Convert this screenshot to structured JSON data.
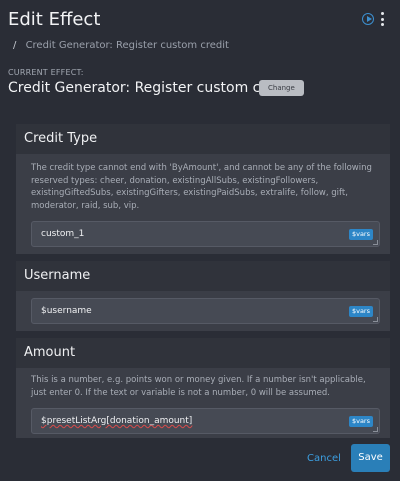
{
  "header": {
    "title": "Edit Effect",
    "play_icon": "play-circle-icon",
    "menu_icon": "kebab-menu-icon"
  },
  "breadcrumb": {
    "separator": "/",
    "current": "Credit Generator: Register custom credit"
  },
  "current_effect": {
    "label": "CURRENT EFFECT:",
    "name": "Credit Generator: Register custom credit",
    "change_label": "Change"
  },
  "credit_type": {
    "heading": "Credit Type",
    "description": "The credit type cannot end with 'ByAmount', and cannot be any of the following reserved types: cheer, donation, existingAllSubs, existingFollowers, existingGiftedSubs, existingGifters, existingPaidSubs, extralife, follow, gift, moderator, raid, sub, vip.",
    "value": "custom_1",
    "vars_label": "$vars"
  },
  "username": {
    "heading": "Username",
    "value": "$username",
    "vars_label": "$vars"
  },
  "amount": {
    "heading": "Amount",
    "description": "This is a number, e.g. points won or money given. If a number isn't applicable, just enter 0. If the text or variable is not a number, 0 will be assumed.",
    "value": "$presetListArg[donation_amount]",
    "vars_label": "$vars"
  },
  "footer": {
    "cancel_label": "Cancel",
    "save_label": "Save"
  },
  "colors": {
    "background": "#2a2d36",
    "accent": "#2d86c7",
    "link": "#3c9ee0"
  }
}
